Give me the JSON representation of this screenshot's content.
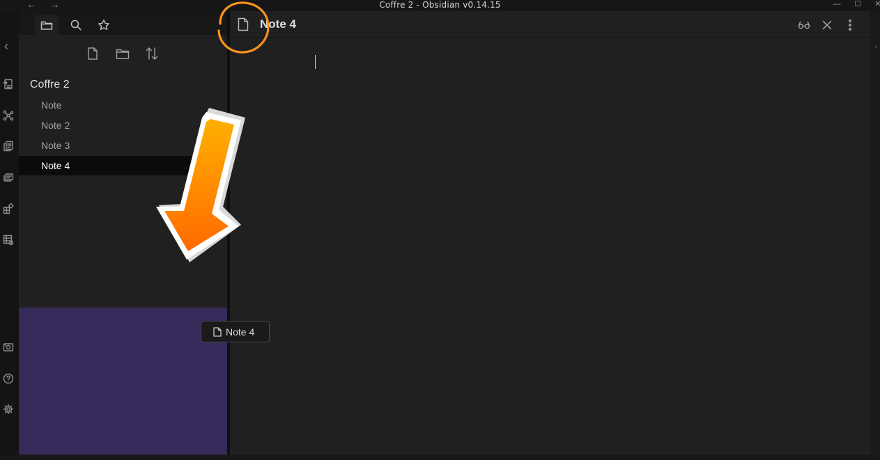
{
  "window": {
    "title": "Coffre 2 - Obsidian v0.14.15",
    "nav": {
      "back": "←",
      "forward": "→"
    },
    "controls": {
      "minimize": "—",
      "maximize": "☐",
      "close": "✕"
    }
  },
  "ribbon": {
    "collapse": "‹",
    "items": [
      {
        "icon": "open-quick-switcher-icon"
      },
      {
        "icon": "graph-view-icon"
      },
      {
        "icon": "templates-icon"
      },
      {
        "icon": "daily-notes-icon"
      },
      {
        "icon": "canvas-plugin-icon"
      },
      {
        "icon": "table-plugin-icon"
      }
    ],
    "bottom": [
      {
        "icon": "vault-switcher-icon"
      },
      {
        "icon": "help-icon"
      },
      {
        "icon": "settings-icon"
      }
    ]
  },
  "sidebar": {
    "tabs": [
      {
        "name": "file-explorer",
        "icon": "folder-icon",
        "active": true
      },
      {
        "name": "search",
        "icon": "search-icon",
        "active": false
      },
      {
        "name": "starred",
        "icon": "star-icon",
        "active": false
      }
    ],
    "actions": [
      {
        "name": "new-note",
        "icon": "new-note-icon"
      },
      {
        "name": "new-folder",
        "icon": "new-folder-icon"
      },
      {
        "name": "sort",
        "icon": "sort-icon"
      }
    ],
    "vault_name": "Coffre 2",
    "files": [
      {
        "label": "Note",
        "active": false
      },
      {
        "label": "Note 2",
        "active": false
      },
      {
        "label": "Note 3",
        "active": false
      },
      {
        "label": "Note 4",
        "active": true
      }
    ],
    "drop_zone_color": "#352a5a"
  },
  "editor": {
    "title": "Note 4",
    "actions": [
      {
        "name": "reading-view",
        "icon": "glasses-icon"
      },
      {
        "name": "close",
        "icon": "close-icon"
      },
      {
        "name": "more-options",
        "icon": "more-vertical-icon"
      }
    ]
  },
  "drag_ghost": {
    "label": "Note 4",
    "icon": "file-icon"
  },
  "annotations": {
    "accent": "#f7931e",
    "arrow_gradient": [
      "#ffb000",
      "#ff6a00"
    ]
  }
}
